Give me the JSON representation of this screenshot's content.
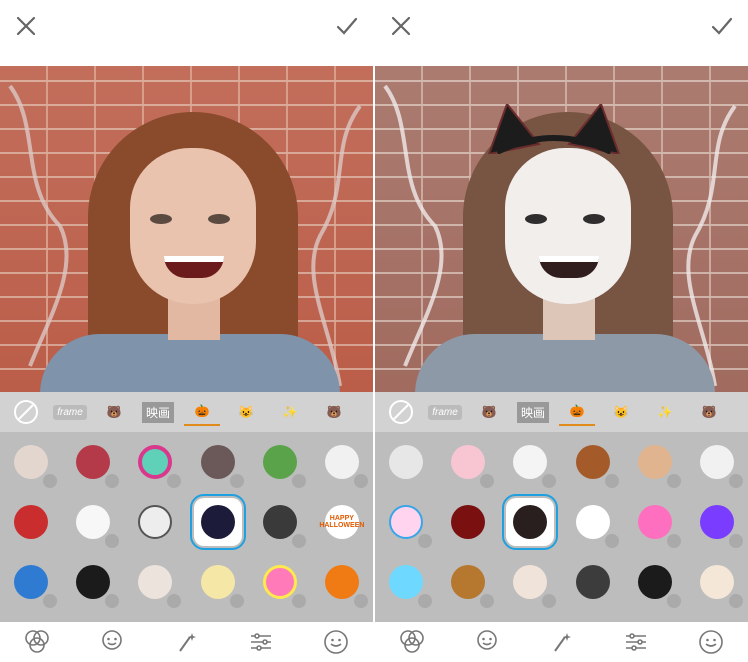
{
  "app": {
    "title": "",
    "left_panel": {
      "categories": [
        {
          "name": "none-icon"
        },
        {
          "name": "frame-icon",
          "label": "frame"
        },
        {
          "name": "bear-icon"
        },
        {
          "name": "eiga-icon",
          "label": "映画"
        },
        {
          "name": "pumpkin-icon",
          "active": true
        },
        {
          "name": "cat-icon"
        },
        {
          "name": "sparkle-icon"
        },
        {
          "name": "bear2-icon"
        }
      ],
      "rows": [
        [
          "ghost-face",
          "clown-girl",
          "frankenstein-ring",
          "zombie-hand",
          "green-monster",
          "white-mask"
        ],
        [
          "red-eye-bow",
          "ghosts",
          "cat-face",
          "dark-eyes",
          "spider",
          "happy-halloween"
        ],
        [
          "blue-skull",
          "black-pumpkins",
          "zombie-girl",
          "mummy",
          "pink-pumpkin",
          "orange-pumpkin"
        ]
      ],
      "sticker_text": {
        "happy_halloween": "HAPPY\nHALLOWEEN"
      }
    },
    "right_panel": {
      "categories": [
        {
          "name": "none-icon"
        },
        {
          "name": "frame-icon",
          "label": "frame"
        },
        {
          "name": "bear-icon"
        },
        {
          "name": "eiga-icon",
          "label": "映画"
        },
        {
          "name": "pumpkin-icon",
          "active": true
        },
        {
          "name": "cat-icon"
        },
        {
          "name": "sparkle-icon"
        },
        {
          "name": "bear2-icon"
        }
      ],
      "rows": [
        [
          "bandage",
          "pig",
          "bunny",
          "teddy",
          "puppy",
          "cat-hat"
        ],
        [
          "blue-cat",
          "red-witch",
          "cat-ears-girl",
          "cards",
          "pink-cat",
          "colorful-squares"
        ],
        [
          "blue-skeleton",
          "hatchet",
          "pale-face",
          "dark-figure",
          "witch-hat",
          "cat-pumpkin"
        ]
      ]
    },
    "bottom": {
      "icons": [
        "filters-icon",
        "face-icon",
        "magic-wand-icon",
        "adjust-icon",
        "smile-icon"
      ]
    }
  },
  "labels": {
    "frame": "frame",
    "eiga": "映画",
    "happy_halloween": "HAPPY HALLOWEEN"
  },
  "colors": {
    "accent_selected": "#1fa0e0",
    "category_active": "#e08a1c"
  }
}
